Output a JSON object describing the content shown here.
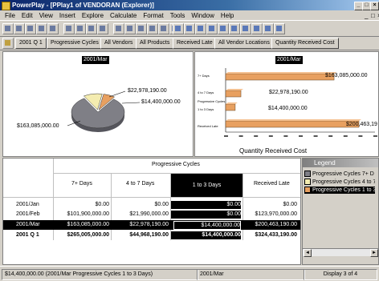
{
  "title": "PowerPlay - [PPlay1 of VENDORAN (Explorer)]",
  "menu": [
    "File",
    "Edit",
    "View",
    "Insert",
    "Explore",
    "Calculate",
    "Format",
    "Tools",
    "Window",
    "Help"
  ],
  "dimensions": [
    "2001 Q 1",
    "Progressive Cycles",
    "All Vendors",
    "All Products",
    "Received Late",
    "All Vendor Locations",
    "Quantity Received Cost"
  ],
  "pie": {
    "title": "",
    "slices": [
      {
        "label": "$163,085,000.00",
        "value": 163085000,
        "color": "#7f7f86"
      },
      {
        "label": "$22,978,190.00",
        "value": 22978190,
        "color": "#f4ecb0"
      },
      {
        "label": "$14,400,000.00",
        "value": 14400000,
        "color": "#e8a060"
      }
    ]
  },
  "bar_chart": {
    "title": "2001/Mar",
    "xlabel": "Quantity Received Cost",
    "category_labels": [
      "7+ Days",
      "4 to 7 Days",
      "Progressive Cycles",
      "1 to 3 Days",
      "Received Late"
    ],
    "bars": [
      {
        "label": "$163,085,000.00",
        "value": 163085000,
        "color": "#e8a060"
      },
      {
        "label": "$22,978,190.00",
        "value": 22978190,
        "color": "#e8a060"
      },
      {
        "label": "$14,400,000.00",
        "value": 14400000,
        "color": "#e8a060"
      },
      {
        "label": "$200,463,19",
        "value": 200463190,
        "color": "#e8a060"
      }
    ]
  },
  "crosstab": {
    "group_header": "Progressive Cycles",
    "columns": [
      "7+ Days",
      "4 to 7 Days",
      "1 to 3 Days",
      "Received Late"
    ],
    "rows": [
      {
        "label": "2001/Jan",
        "values": [
          "$0.00",
          "$0.00",
          "$0.00",
          "$0.00"
        ]
      },
      {
        "label": "2001/Feb",
        "values": [
          "$101,900,000.00",
          "$21,990,000.00",
          "$0.00",
          "$123,970,000.00"
        ]
      },
      {
        "label": "2001/Mar",
        "values": [
          "$163,085,000.00",
          "$22,978,190.00",
          "$14,400,000.00",
          "$200,463,190.00"
        ]
      },
      {
        "label": "2001 Q 1",
        "values": [
          "$265,005,000.00",
          "$44,968,190.00",
          "$14,400,000.00",
          "$324,433,190.00"
        ]
      }
    ]
  },
  "legend": {
    "title": "Legend",
    "items": [
      {
        "label": "Progressive Cycles 7+ D",
        "color": "#7f7f86"
      },
      {
        "label": "Progressive Cycles 4 to 7",
        "color": "#f4ecb0"
      },
      {
        "label": "Progressive Cycles 1 to 3",
        "color": "#e8a060"
      }
    ]
  },
  "status": {
    "main": "$14,400,000.00  (2001/Mar Progressive Cycles 1 to 3 Days)",
    "period": "2001/Mar",
    "display": "Display 3 of 4"
  }
}
